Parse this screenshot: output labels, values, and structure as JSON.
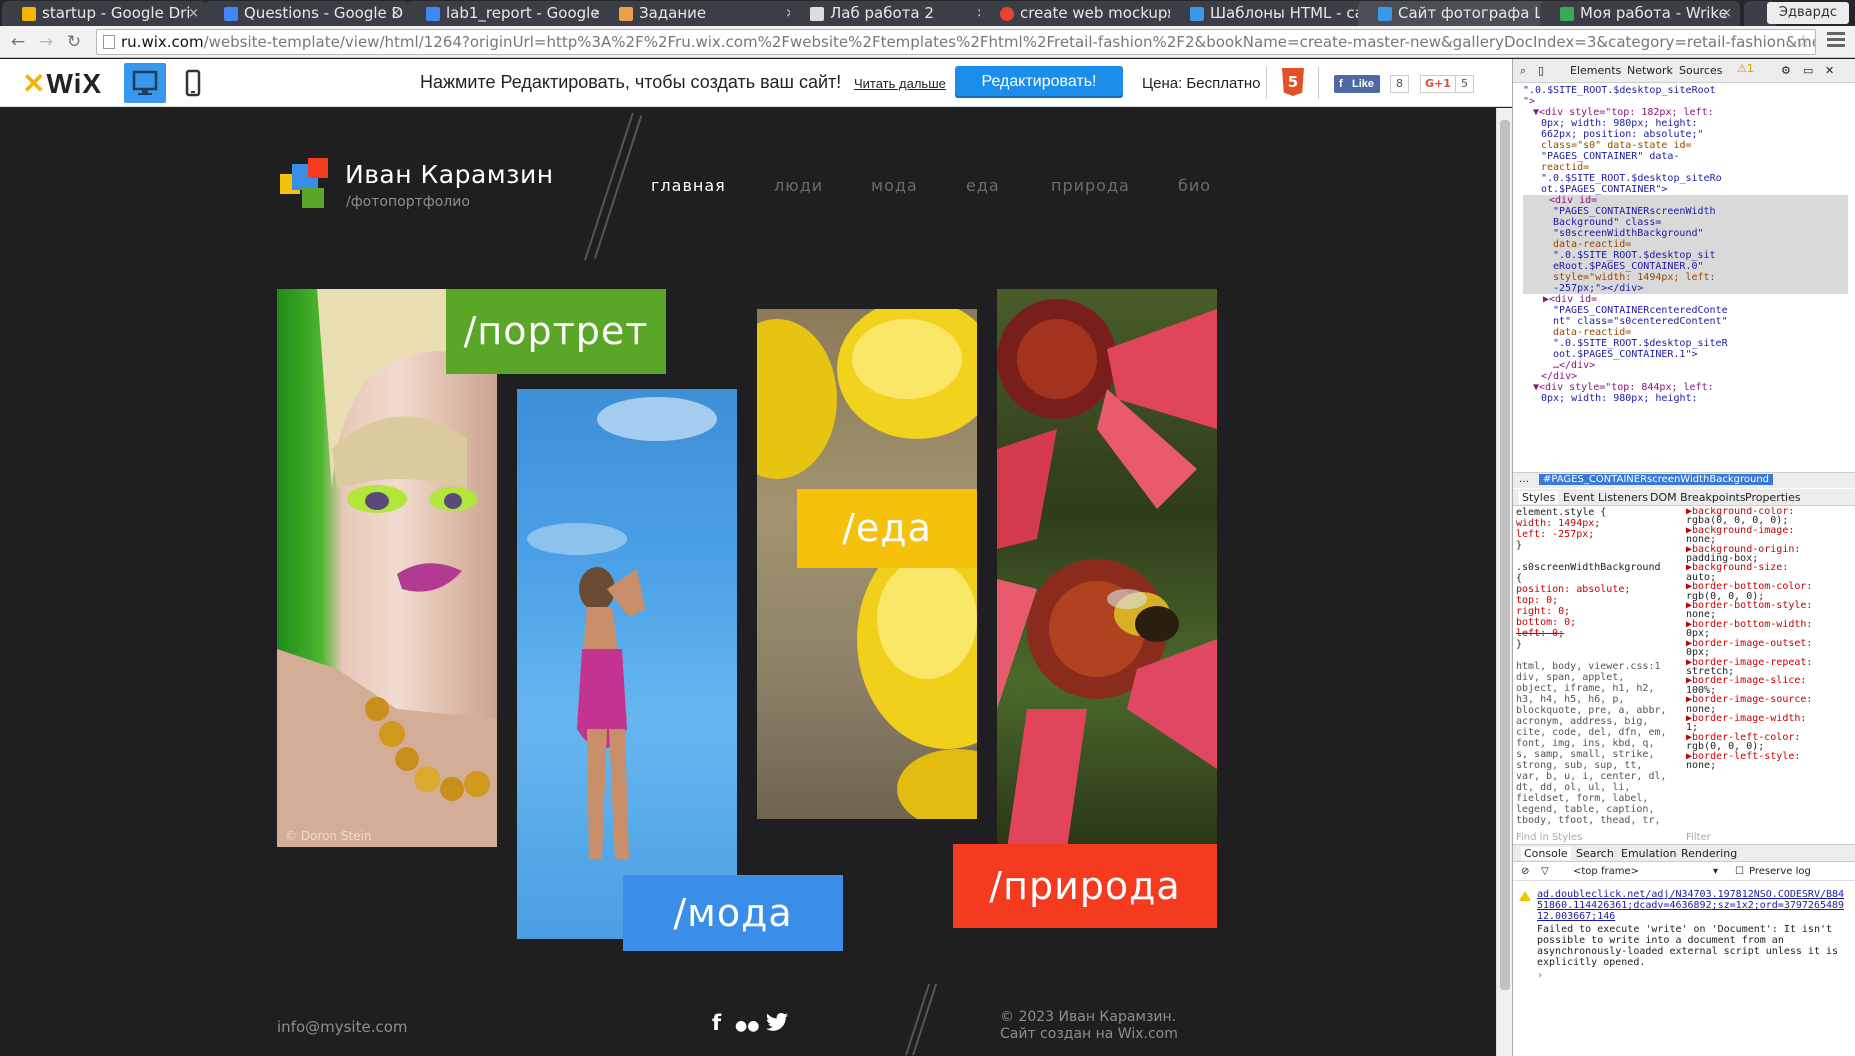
{
  "browser": {
    "tabs": [
      {
        "title": "startup - Google Dri",
        "color": "#f4b400"
      },
      {
        "title": "Questions - Google D",
        "color": "#4285f4"
      },
      {
        "title": "lab1_report - Google",
        "color": "#4285f4"
      },
      {
        "title": "Задание",
        "color": "#e8a04c"
      },
      {
        "title": "Лаб работа 2",
        "color": "#dddddd"
      },
      {
        "title": "create web mockups",
        "color": "#ea4335"
      },
      {
        "title": "Шаблоны HTML - са",
        "color": "#3899ec"
      },
      {
        "title": "Сайт фотографа Ша",
        "color": "#3899ec"
      },
      {
        "title": "Моя работа - Wrike",
        "color": "#3da758"
      }
    ],
    "profile": "Эдвардс",
    "url_host": "ru.wix.com",
    "url_rest": "/website-template/view/html/1264?originUrl=http%3A%2F%2Fru.wix.com%2Fwebsite%2Ftemplates%2Fhtml%2Fretail-fashion%2F2&bookName=create-master-new&galleryDocIndex=3&category=retail-fashion&metaSiteId="
  },
  "wix_bar": {
    "logo": "WiX",
    "promo": "Нажмите Редактировать, чтобы создать ваш сайт!",
    "read_more": "Читать дальше",
    "edit_button": "Редактировать!",
    "price": "Цена: Бесплатно",
    "like_label": "Like",
    "like_count": "8",
    "gplus_label": "G+1",
    "gplus_count": "5"
  },
  "site": {
    "brand_name": "Иван Карамзин",
    "brand_sub": "/фотопортфолио",
    "nav": [
      "главная",
      "люди",
      "мода",
      "еда",
      "природа",
      "био"
    ],
    "tiles": {
      "portrait": "/портрет",
      "fashion": "/мода",
      "food": "/еда",
      "nature": "/природа"
    },
    "watermark": "© Doron Stein",
    "footer_email": "info@mysite.com",
    "footer_copy_1": "© 2023 Иван Карамзин.",
    "footer_copy_2": "Сайт создан на Wix.com",
    "colors": {
      "green": "#5aa627",
      "blue": "#3a8ee8",
      "yellow": "#f5c10a",
      "red": "#f43b1f"
    }
  },
  "devtools": {
    "tabs": [
      "Elements",
      "Network",
      "Sources"
    ],
    "warnings": "1",
    "code_lines": [
      "\".0.$SITE_ROOT.$desktop_siteRoot",
      "\">",
      "▼<div style=\"top: 182px; left:",
      "0px; width: 980px; height:",
      "662px; position: absolute;\"",
      "class=\"s0\" data-state id=",
      "\"PAGES_CONTAINER\" data-",
      "reactid=",
      "\".0.$SITE_ROOT.$desktop_siteRo",
      "ot.$PAGES_CONTAINER\">",
      "<div id=",
      "\"PAGES_CONTAINERscreenWidth",
      "Background\" class=",
      "\"s0screenWidthBackground\"",
      "data-reactid=",
      "\".0.$SITE_ROOT.$desktop_sit",
      "eRoot.$PAGES_CONTAINER.0\"",
      "style=\"width: 1494px; left:",
      "-257px;\"></div>",
      "▶<div id=",
      "\"PAGES_CONTAINERcenteredConte",
      "nt\" class=\"s0centeredContent\"",
      "data-reactid=",
      "\".0.$SITE_ROOT.$desktop_siteR",
      "oot.$PAGES_CONTAINER.1\">",
      "…</div>",
      "</div>",
      "▼<div style=\"top: 844px; left:",
      "0px; width: 980px; height:"
    ],
    "crumb": "#PAGES_CONTAINERscreenWidthBackground",
    "subtabs": [
      "Styles",
      "Event Listeners",
      "DOM Breakpoints",
      "Properties"
    ],
    "styles_lines": [
      "element.style {",
      "  width: 1494px;",
      "  left: -257px;",
      "}",
      "",
      ".s0screenWidthBackground",
      "{",
      "  position: absolute;",
      "  top: 0;",
      "  right: 0;",
      "  bottom: 0;",
      "  left: 0;",
      "}",
      "",
      "html, body,   viewer.css:1",
      "div, span, applet,",
      "object, iframe, h1, h2,",
      "h3, h4, h5, h6, p,",
      "blockquote, pre, a, abbr,",
      "acronym, address, big,",
      "cite, code, del, dfn, em,",
      "font, img, ins, kbd, q,",
      "s, samp, small, strike,",
      "strong, sub, sup, tt,",
      "var, b, u, i, center, dl,",
      "dt, dd, ol, ul, li,",
      "fieldset, form, label,",
      "legend, table, caption,",
      "tbody, tfoot, thead, tr,"
    ],
    "computed_lines": [
      "▶background-color:",
      "  rgba(0, 0, 0, 0);",
      "▶background-image:",
      "  none;",
      "▶background-origin:",
      "  padding-box;",
      "▶background-size:",
      "  auto;",
      "▶border-bottom-color:",
      "  rgb(0, 0, 0);",
      "▶border-bottom-style:",
      "  none;",
      "▶border-bottom-width:",
      "  0px;",
      "▶border-image-outset:",
      "  0px;",
      "▶border-image-repeat:",
      "  stretch;",
      "▶border-image-slice:",
      "  100%;",
      "▶border-image-source:",
      "  none;",
      "▶border-image-width:",
      "  1;",
      "▶border-left-color:",
      "  rgb(0, 0, 0);",
      "▶border-left-style:",
      "  none;"
    ],
    "find_placeholder": "Find in Styles",
    "filter_placeholder": "Filter",
    "bottom_tabs": [
      "Console",
      "Search",
      "Emulation",
      "Rendering"
    ],
    "frame": "<top frame>",
    "preserve_log": "Preserve log",
    "console_link": "ad.doubleclick.net/adj/N34703.197812NSO.CODESRV/B8451860.114426361;dcadv=4636892;sz=1x2;ord=379726548912.003667;146",
    "console_msg": "Failed to execute 'write' on 'Document': It isn't possible to write into a document from an asynchronously-loaded external script unless it is explicitly opened."
  }
}
